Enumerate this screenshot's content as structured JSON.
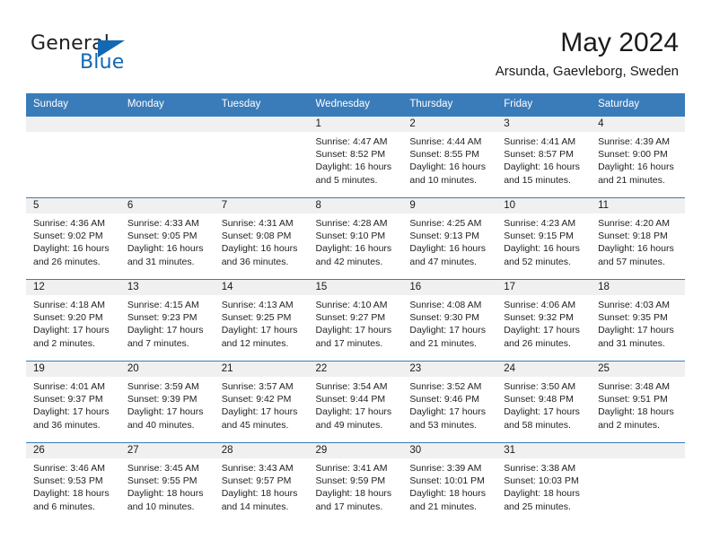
{
  "brand": {
    "name_part1": "General",
    "name_part2": "Blue",
    "accent_color": "#1268b3"
  },
  "header": {
    "month_title": "May 2024",
    "location": "Arsunda, Gaevleborg, Sweden"
  },
  "theme": {
    "header_row_bg": "#3a7cba",
    "daynum_bg": "#f0f0f0",
    "page_bg": "#ffffff",
    "text_color": "#1a1a1a"
  },
  "calendar": {
    "weekday_headers": [
      "Sunday",
      "Monday",
      "Tuesday",
      "Wednesday",
      "Thursday",
      "Friday",
      "Saturday"
    ],
    "labels": {
      "sunrise": "Sunrise:",
      "sunset": "Sunset:",
      "daylight": "Daylight:"
    },
    "weeks": [
      [
        {
          "day": ""
        },
        {
          "day": ""
        },
        {
          "day": ""
        },
        {
          "day": "1",
          "sunrise": "Sunrise: 4:47 AM",
          "sunset": "Sunset: 8:52 PM",
          "daylight": "Daylight: 16 hours and 5 minutes."
        },
        {
          "day": "2",
          "sunrise": "Sunrise: 4:44 AM",
          "sunset": "Sunset: 8:55 PM",
          "daylight": "Daylight: 16 hours and 10 minutes."
        },
        {
          "day": "3",
          "sunrise": "Sunrise: 4:41 AM",
          "sunset": "Sunset: 8:57 PM",
          "daylight": "Daylight: 16 hours and 15 minutes."
        },
        {
          "day": "4",
          "sunrise": "Sunrise: 4:39 AM",
          "sunset": "Sunset: 9:00 PM",
          "daylight": "Daylight: 16 hours and 21 minutes."
        }
      ],
      [
        {
          "day": "5",
          "sunrise": "Sunrise: 4:36 AM",
          "sunset": "Sunset: 9:02 PM",
          "daylight": "Daylight: 16 hours and 26 minutes."
        },
        {
          "day": "6",
          "sunrise": "Sunrise: 4:33 AM",
          "sunset": "Sunset: 9:05 PM",
          "daylight": "Daylight: 16 hours and 31 minutes."
        },
        {
          "day": "7",
          "sunrise": "Sunrise: 4:31 AM",
          "sunset": "Sunset: 9:08 PM",
          "daylight": "Daylight: 16 hours and 36 minutes."
        },
        {
          "day": "8",
          "sunrise": "Sunrise: 4:28 AM",
          "sunset": "Sunset: 9:10 PM",
          "daylight": "Daylight: 16 hours and 42 minutes."
        },
        {
          "day": "9",
          "sunrise": "Sunrise: 4:25 AM",
          "sunset": "Sunset: 9:13 PM",
          "daylight": "Daylight: 16 hours and 47 minutes."
        },
        {
          "day": "10",
          "sunrise": "Sunrise: 4:23 AM",
          "sunset": "Sunset: 9:15 PM",
          "daylight": "Daylight: 16 hours and 52 minutes."
        },
        {
          "day": "11",
          "sunrise": "Sunrise: 4:20 AM",
          "sunset": "Sunset: 9:18 PM",
          "daylight": "Daylight: 16 hours and 57 minutes."
        }
      ],
      [
        {
          "day": "12",
          "sunrise": "Sunrise: 4:18 AM",
          "sunset": "Sunset: 9:20 PM",
          "daylight": "Daylight: 17 hours and 2 minutes."
        },
        {
          "day": "13",
          "sunrise": "Sunrise: 4:15 AM",
          "sunset": "Sunset: 9:23 PM",
          "daylight": "Daylight: 17 hours and 7 minutes."
        },
        {
          "day": "14",
          "sunrise": "Sunrise: 4:13 AM",
          "sunset": "Sunset: 9:25 PM",
          "daylight": "Daylight: 17 hours and 12 minutes."
        },
        {
          "day": "15",
          "sunrise": "Sunrise: 4:10 AM",
          "sunset": "Sunset: 9:27 PM",
          "daylight": "Daylight: 17 hours and 17 minutes."
        },
        {
          "day": "16",
          "sunrise": "Sunrise: 4:08 AM",
          "sunset": "Sunset: 9:30 PM",
          "daylight": "Daylight: 17 hours and 21 minutes."
        },
        {
          "day": "17",
          "sunrise": "Sunrise: 4:06 AM",
          "sunset": "Sunset: 9:32 PM",
          "daylight": "Daylight: 17 hours and 26 minutes."
        },
        {
          "day": "18",
          "sunrise": "Sunrise: 4:03 AM",
          "sunset": "Sunset: 9:35 PM",
          "daylight": "Daylight: 17 hours and 31 minutes."
        }
      ],
      [
        {
          "day": "19",
          "sunrise": "Sunrise: 4:01 AM",
          "sunset": "Sunset: 9:37 PM",
          "daylight": "Daylight: 17 hours and 36 minutes."
        },
        {
          "day": "20",
          "sunrise": "Sunrise: 3:59 AM",
          "sunset": "Sunset: 9:39 PM",
          "daylight": "Daylight: 17 hours and 40 minutes."
        },
        {
          "day": "21",
          "sunrise": "Sunrise: 3:57 AM",
          "sunset": "Sunset: 9:42 PM",
          "daylight": "Daylight: 17 hours and 45 minutes."
        },
        {
          "day": "22",
          "sunrise": "Sunrise: 3:54 AM",
          "sunset": "Sunset: 9:44 PM",
          "daylight": "Daylight: 17 hours and 49 minutes."
        },
        {
          "day": "23",
          "sunrise": "Sunrise: 3:52 AM",
          "sunset": "Sunset: 9:46 PM",
          "daylight": "Daylight: 17 hours and 53 minutes."
        },
        {
          "day": "24",
          "sunrise": "Sunrise: 3:50 AM",
          "sunset": "Sunset: 9:48 PM",
          "daylight": "Daylight: 17 hours and 58 minutes."
        },
        {
          "day": "25",
          "sunrise": "Sunrise: 3:48 AM",
          "sunset": "Sunset: 9:51 PM",
          "daylight": "Daylight: 18 hours and 2 minutes."
        }
      ],
      [
        {
          "day": "26",
          "sunrise": "Sunrise: 3:46 AM",
          "sunset": "Sunset: 9:53 PM",
          "daylight": "Daylight: 18 hours and 6 minutes."
        },
        {
          "day": "27",
          "sunrise": "Sunrise: 3:45 AM",
          "sunset": "Sunset: 9:55 PM",
          "daylight": "Daylight: 18 hours and 10 minutes."
        },
        {
          "day": "28",
          "sunrise": "Sunrise: 3:43 AM",
          "sunset": "Sunset: 9:57 PM",
          "daylight": "Daylight: 18 hours and 14 minutes."
        },
        {
          "day": "29",
          "sunrise": "Sunrise: 3:41 AM",
          "sunset": "Sunset: 9:59 PM",
          "daylight": "Daylight: 18 hours and 17 minutes."
        },
        {
          "day": "30",
          "sunrise": "Sunrise: 3:39 AM",
          "sunset": "Sunset: 10:01 PM",
          "daylight": "Daylight: 18 hours and 21 minutes."
        },
        {
          "day": "31",
          "sunrise": "Sunrise: 3:38 AM",
          "sunset": "Sunset: 10:03 PM",
          "daylight": "Daylight: 18 hours and 25 minutes."
        },
        {
          "day": ""
        }
      ]
    ]
  }
}
